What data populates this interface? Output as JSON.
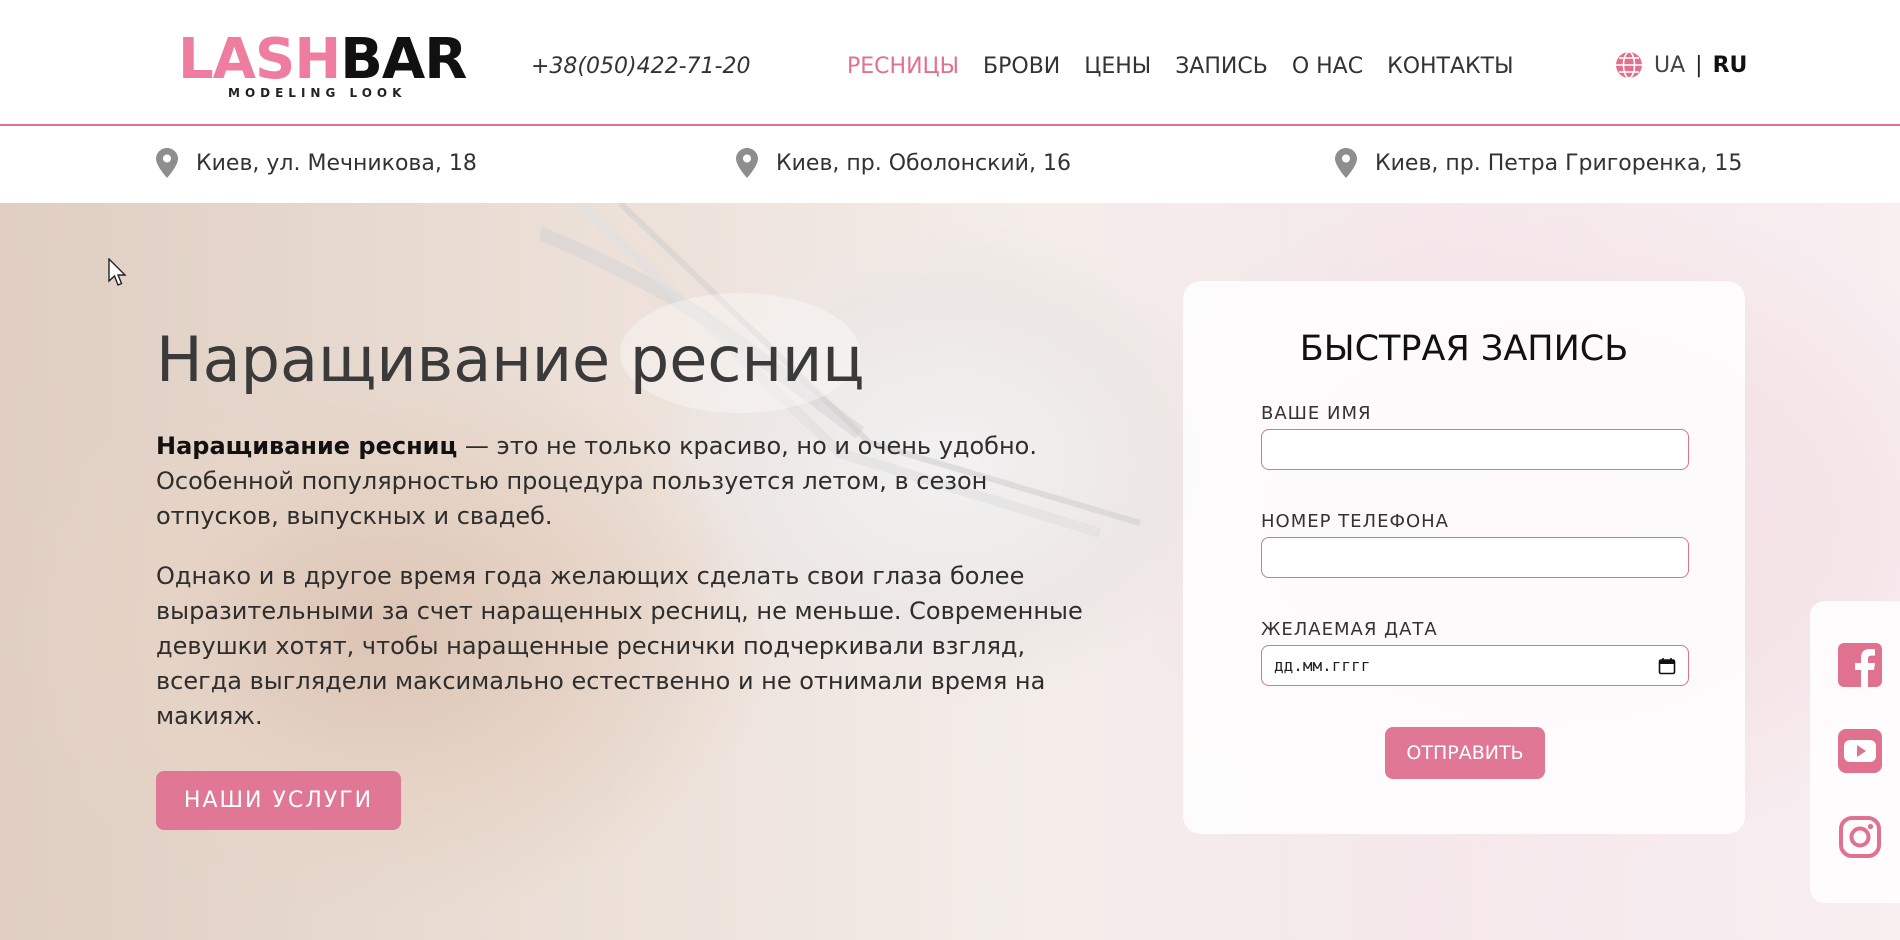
{
  "header": {
    "logo": {
      "part1": "LASH",
      "part2": "BAR",
      "tagline": "MODELING LOOK"
    },
    "phone": "+38(050)422-71-20",
    "nav": [
      "РЕСНИЦЫ",
      "БРОВИ",
      "ЦЕНЫ",
      "ЗАПИСЬ",
      "О НАС",
      "КОНТАКТЫ"
    ],
    "active_nav": "РЕСНИЦЫ",
    "lang": {
      "ua": "UA",
      "sep": "|",
      "ru": "RU",
      "selected": "RU"
    }
  },
  "addresses": [
    "Киев, ул. Мечникова, 18",
    "Киев, пр. Оболонский, 16",
    "Киев, пр. Петра Григоренка, 15"
  ],
  "hero": {
    "title": "Наращивание ресниц",
    "p1_bold": "Наращивание ресниц",
    "p1_rest": " — это не только красиво, но и очень удобно. Особенной популярностью процедура пользуется летом, в сезон отпусков, выпускных и свадеб.",
    "p2": "Однако и в другое время года желающих сделать свои глаза более выразительными за счет наращенных ресниц, не меньше. Современные девушки хотят, чтобы наращенные реснички подчеркивали взгляд, всегда выглядели максимально естественно и не отнимали время на макияж.",
    "button": "НАШИ УСЛУГИ"
  },
  "form": {
    "title": "БЫСТРАЯ ЗАПИСЬ",
    "name_label": "ВАШЕ ИМЯ",
    "name_value": "",
    "phone_label": "НОМЕР ТЕЛЕФОНА",
    "phone_value": "",
    "date_label": "ЖЕЛАЕМАЯ ДАТА",
    "date_placeholder": "дд.мм.гггг",
    "submit": "ОТПРАВИТЬ"
  },
  "social": [
    "facebook-icon",
    "youtube-icon",
    "instagram-icon"
  ],
  "colors": {
    "accent": "#e0718f",
    "logo_pink": "#ef7da0",
    "button": "#df7795"
  }
}
